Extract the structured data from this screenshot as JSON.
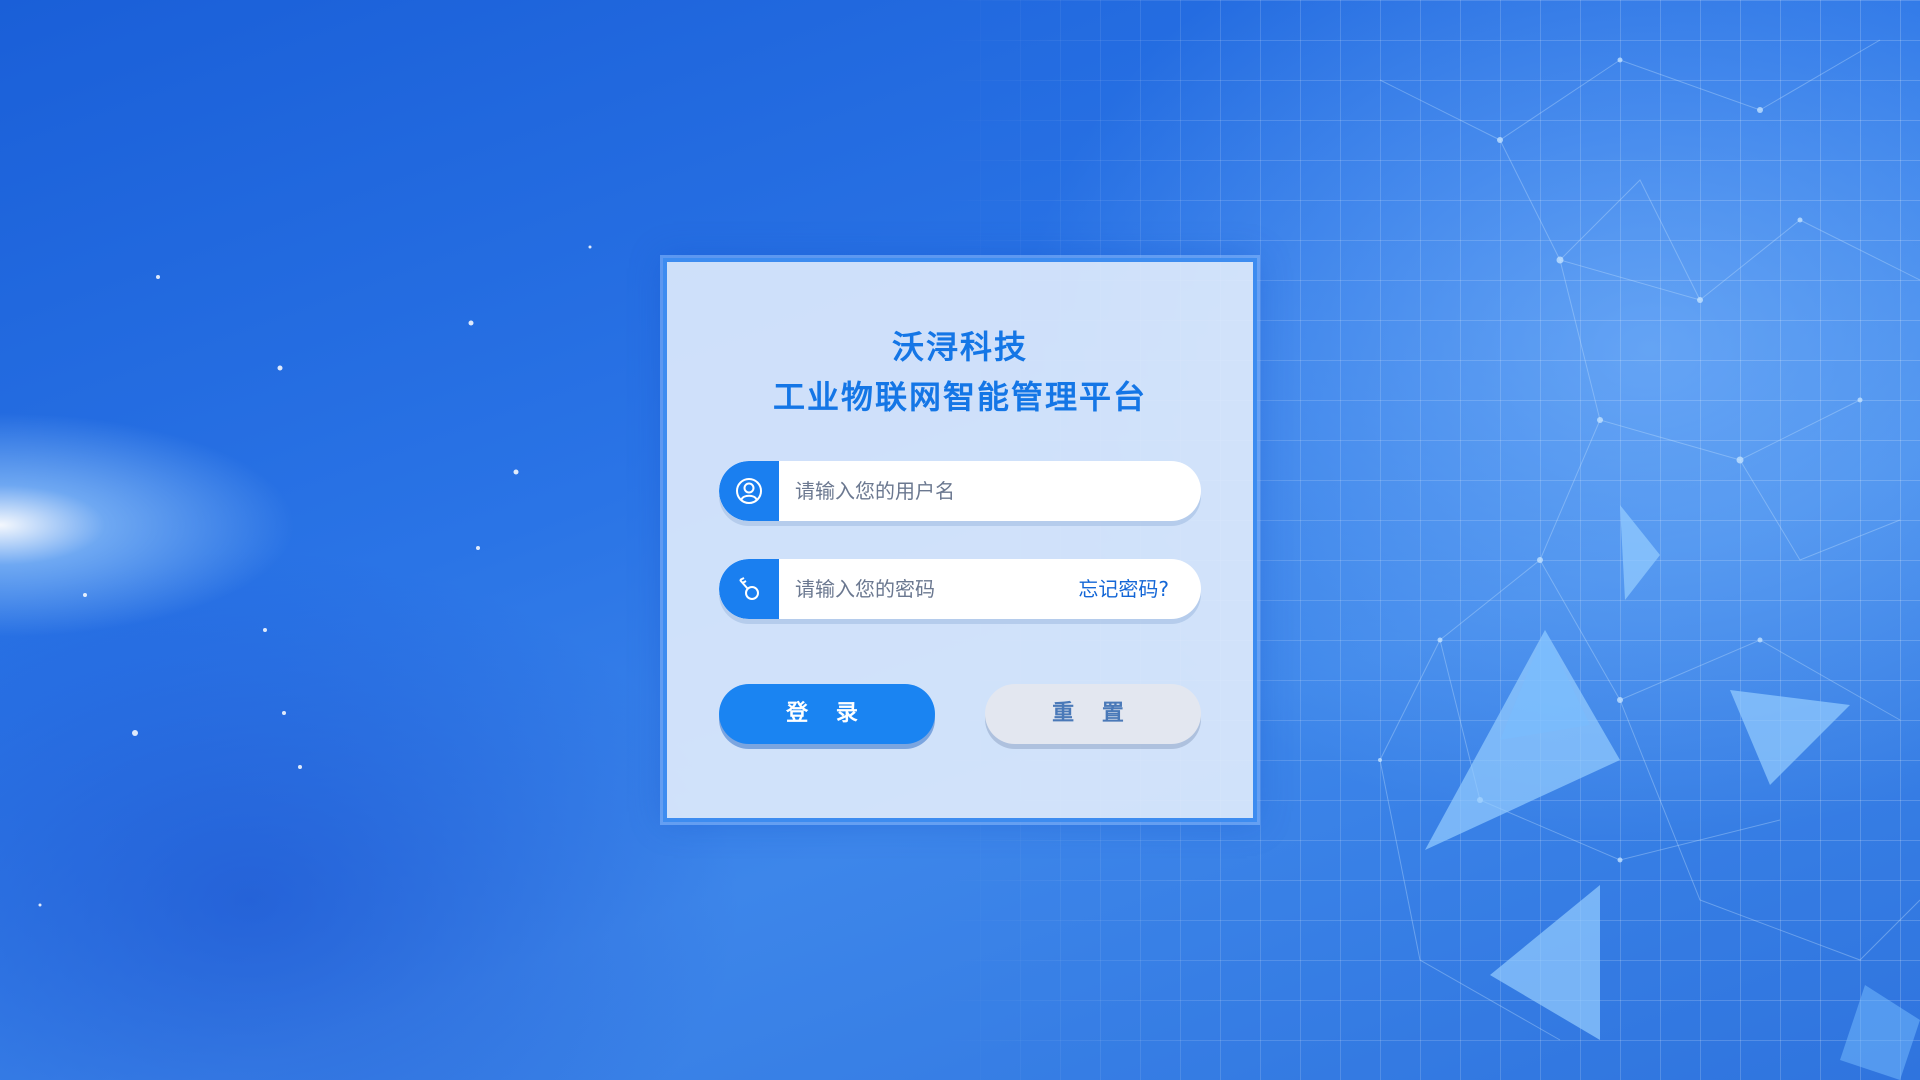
{
  "login": {
    "company_name": "沃浔科技",
    "platform_name": "工业物联网智能管理平台",
    "username": {
      "placeholder": "请输入您的用户名",
      "value": ""
    },
    "password": {
      "placeholder": "请输入您的密码",
      "value": ""
    },
    "forgot_password_label": "忘记密码?",
    "login_button_label": "登 录",
    "reset_button_label": "重 置"
  },
  "icons": {
    "username": "user-icon",
    "password": "key-icon"
  },
  "colors": {
    "accent": "#1a84f2",
    "title": "#1476e6",
    "card_border": "#3d8cf0",
    "reset_button": "#e3e7f0"
  }
}
